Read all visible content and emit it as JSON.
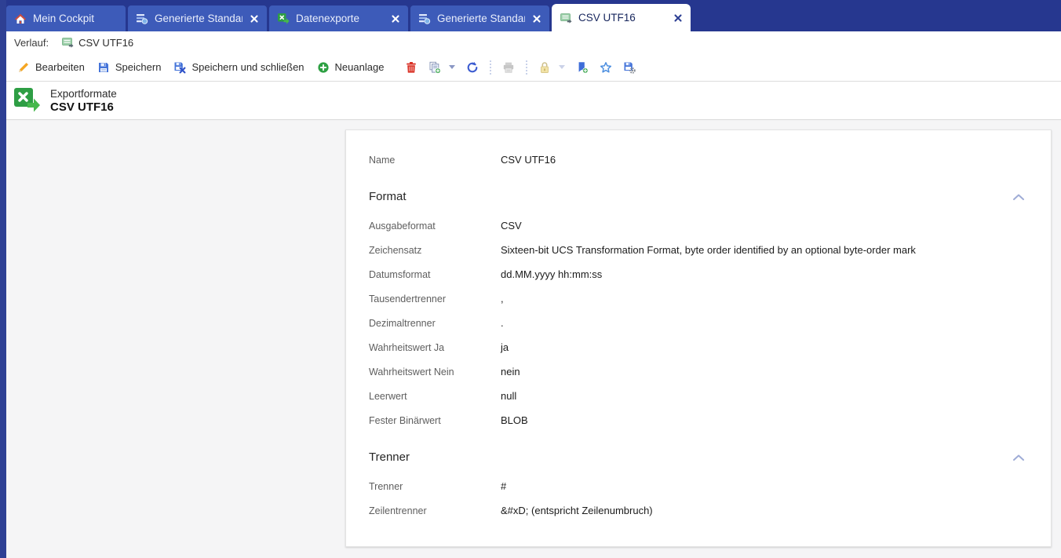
{
  "tabs": [
    {
      "label": "Mein Cockpit",
      "icon": "home-icon",
      "active": false,
      "closable": false
    },
    {
      "label": "Generierte Standar...",
      "icon": "report-search-icon",
      "active": false,
      "closable": true
    },
    {
      "label": "Datenexporte",
      "icon": "export-icon",
      "active": false,
      "closable": true
    },
    {
      "label": "Generierte Standar...",
      "icon": "report-search-icon",
      "active": false,
      "closable": true
    },
    {
      "label": "CSV UTF16",
      "icon": "csv-icon",
      "active": true,
      "closable": true
    }
  ],
  "history_bar": {
    "label": "Verlauf:",
    "items": [
      {
        "label": "CSV UTF16",
        "icon": "csv-icon"
      }
    ]
  },
  "toolbar": {
    "edit_label": "Bearbeiten",
    "save_label": "Speichern",
    "save_close_label": "Speichern und schließen",
    "new_label": "Neuanlage",
    "icon_buttons": [
      "delete",
      "copy",
      "refresh",
      "print",
      "lock",
      "bookmark-add",
      "favorite",
      "save-settings"
    ]
  },
  "header": {
    "type_label": "Exportformate",
    "title": "CSV UTF16"
  },
  "form": {
    "rows": [
      {
        "type": "field",
        "label": "Name",
        "value": "CSV UTF16"
      },
      {
        "type": "section",
        "title": "Format"
      },
      {
        "type": "field",
        "label": "Ausgabeformat",
        "value": "CSV"
      },
      {
        "type": "field",
        "label": "Zeichensatz",
        "value": "Sixteen-bit UCS Transformation Format, byte order identified by an optional byte-order mark"
      },
      {
        "type": "field",
        "label": "Datumsformat",
        "value": "dd.MM.yyyy hh:mm:ss"
      },
      {
        "type": "field",
        "label": "Tausendertrenner",
        "value": ","
      },
      {
        "type": "field",
        "label": "Dezimaltrenner",
        "value": "."
      },
      {
        "type": "field",
        "label": "Wahrheitswert Ja",
        "value": "ja"
      },
      {
        "type": "field",
        "label": "Wahrheitswert Nein",
        "value": "nein"
      },
      {
        "type": "field",
        "label": "Leerwert",
        "value": "null"
      },
      {
        "type": "field",
        "label": "Fester Binärwert",
        "value": "BLOB"
      },
      {
        "type": "section",
        "title": "Trenner"
      },
      {
        "type": "field",
        "label": "Trenner",
        "value": "#"
      },
      {
        "type": "field",
        "label": "Zeilentrenner",
        "value": "&#xD; (entspricht Zeilenumbruch)"
      }
    ]
  },
  "colors": {
    "topbar_navy": "#26378f",
    "tab_blue": "#3d5bb9",
    "active_tab_text": "#16255c",
    "accent_green": "#2e9e44",
    "delete_red": "#d93025",
    "edit_orange": "#f5a623",
    "refresh_blue": "#3b5bd0",
    "chevron_blue": "#9facd6"
  }
}
